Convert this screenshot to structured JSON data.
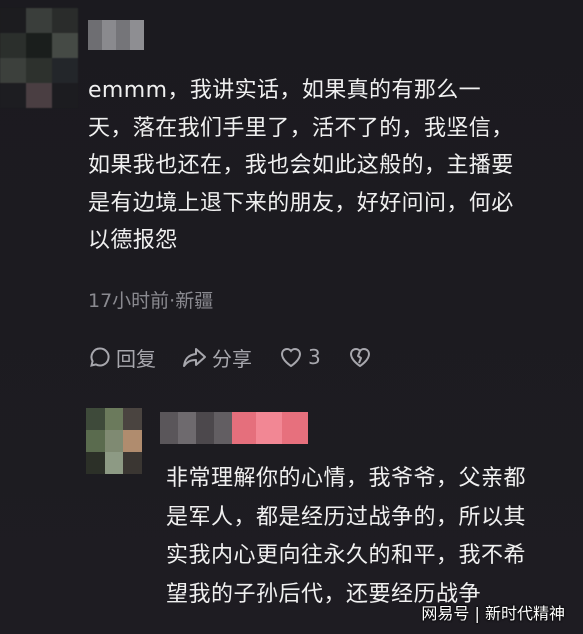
{
  "comment": {
    "text_lines": [
      "emmm，我讲实话，如果真的有那么一",
      "天，落在我们手里了，活不了的，我坚信，",
      "如果我也还在，我也会如此这般的，主播要",
      "是有边境上退下来的朋友，好好问问，何必",
      "以德报怨"
    ],
    "meta": "17小时前·新疆",
    "actions": {
      "reply_label": "回复",
      "share_label": "分享",
      "like_count": "3"
    }
  },
  "reply": {
    "text_lines": [
      "非常理解你的心情，我爷爷，父亲都",
      "是军人，都是经历过战争的，所以其",
      "实我内心更向往永久的和平，我不希",
      "望我的子孙后代，还要经历战争"
    ]
  },
  "watermark": "网易号 | 新时代精神",
  "colors": {
    "background": "#1c1b20",
    "text": "#f0f0f0",
    "meta": "#8a8a90",
    "action": "#a7a7ad",
    "reply_name_accent": "#e56f7c"
  },
  "icons": {
    "reply": "comment-bubble-icon",
    "share": "share-arrow-icon",
    "like": "heart-icon",
    "dislike": "broken-heart-icon"
  }
}
